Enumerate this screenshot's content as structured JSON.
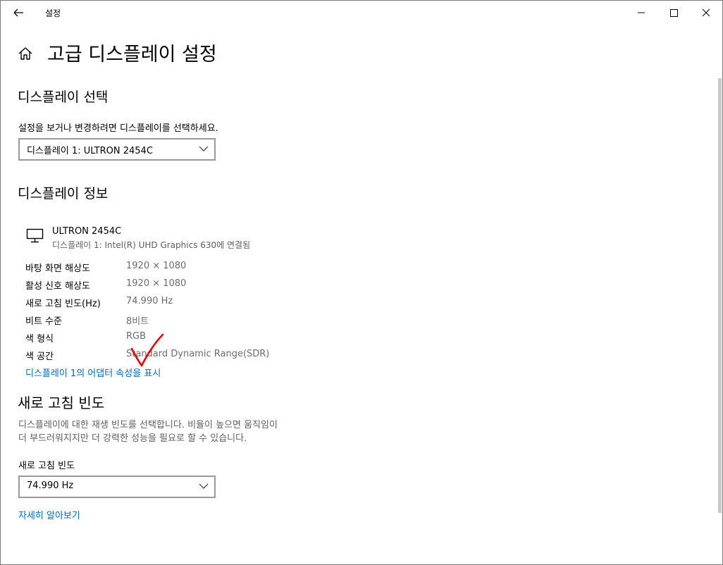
{
  "window": {
    "title": "설정",
    "controls": [
      "minimize",
      "maximize",
      "close"
    ]
  },
  "page": {
    "title": "고급 디스플레이 설정"
  },
  "select_display": {
    "heading": "디스플레이 선택",
    "description": "설정을 보거나 변경하려면 디스플레이를 선택하세요.",
    "dropdown_value": "디스플레이 1: ULTRON 2454C"
  },
  "display_info": {
    "heading": "디스플레이 정보",
    "monitor_name": "ULTRON 2454C",
    "monitor_connection": "디스플레이 1: Intel(R) UHD Graphics 630에 연결됨",
    "rows": [
      {
        "label": "바탕 화면 해상도",
        "value": "1920 × 1080"
      },
      {
        "label": "활성 신호 해상도",
        "value": "1920 × 1080"
      },
      {
        "label": "새로 고침 빈도(Hz)",
        "value": "74.990 Hz"
      },
      {
        "label": "비트 수준",
        "value": "8비트"
      },
      {
        "label": "색 형식",
        "value": "RGB"
      },
      {
        "label": "색 공간",
        "value": "Standard Dynamic Range(SDR)"
      }
    ],
    "adapter_link": "디스플레이 1의 어댑터 속성을 표시"
  },
  "refresh_rate": {
    "heading": "새로 고침 빈도",
    "description_line1": "디스플레이에 대한 재생 빈도를 선택합니다. 비율이 높으면 움직임이",
    "description_line2": "더 부드러워지지만 더 강력한 성능을 필요로 할 수 있습니다.",
    "field_label": "새로 고침 빈도",
    "dropdown_value": "74.990 Hz",
    "learn_more_link": "자세히 알아보기"
  },
  "annotation": {
    "color": "#e00000",
    "icon": "red-checkmark-icon"
  },
  "colors": {
    "link": "#0067b8",
    "secondary_text": "#6b6b6b",
    "dropdown_border": "#999999"
  }
}
